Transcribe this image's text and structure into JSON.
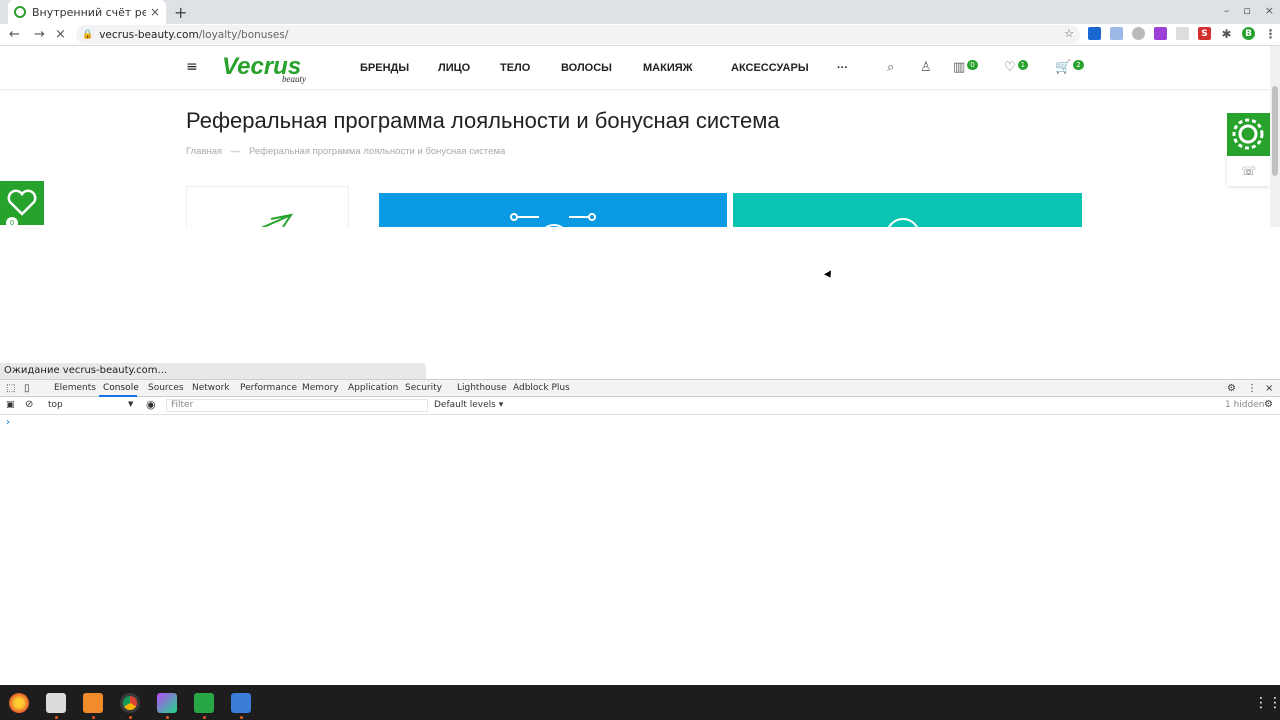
{
  "browser": {
    "tab_title": "Внутренний счёт рефер",
    "tab_close": "×",
    "new_tab": "+",
    "url_host": "vecrus-beauty.com",
    "url_path": "/loyalty/bonuses/",
    "profile_letter": "В",
    "window_controls": [
      "–",
      "▫",
      "×"
    ]
  },
  "site": {
    "logo_main": "Vecrus",
    "logo_sub": "beauty",
    "nav": [
      "БРЕНДЫ",
      "ЛИЦО",
      "ТЕЛО",
      "ВОЛОСЫ",
      "МАКИЯЖ",
      "АКСЕССУАРЫ",
      "···"
    ],
    "compare_count": "0",
    "favorites_count": "1",
    "cart_count": "2",
    "page_title": "Реферальная программа лояльности и бонусная система",
    "breadcrumb_home": "Главная",
    "breadcrumb_sep": "—",
    "breadcrumb_current": "Реферальная программа лояльности и бонусная система",
    "left_favorites_count": "0"
  },
  "status_text": "Ожидание vecrus-beauty.com...",
  "devtools": {
    "tabs": [
      "Elements",
      "Console",
      "Sources",
      "Network",
      "Performance",
      "Memory",
      "Application",
      "Security",
      "Lighthouse",
      "Adblock Plus"
    ],
    "active_tab": "Console",
    "context": "top",
    "filter_placeholder": "Filter",
    "levels": "Default levels ▾",
    "hidden": "1 hidden",
    "prompt": "›"
  },
  "colors": {
    "brand_green": "#27a22c",
    "card_blue": "#0a99e3",
    "card_teal": "#0bc3b1",
    "devtools_accent": "#1a73e8"
  },
  "taskbar_apps": [
    "firefox-icon",
    "files-icon",
    "sublime-icon",
    "chrome-icon",
    "phpstorm-icon",
    "spreadsheet-icon",
    "app-icon"
  ]
}
